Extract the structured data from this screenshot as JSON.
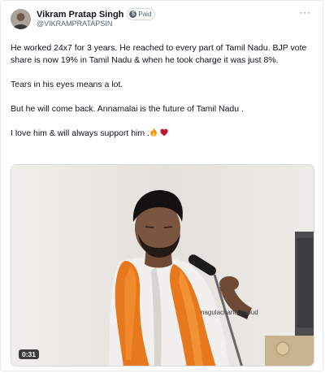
{
  "post": {
    "author_name": "Vikram Pratap Singh",
    "badge_label": "Paid",
    "handle": "@VIKRAMPRATAPSIN",
    "more_label": "···",
    "paragraphs": [
      "He worked 24x7 for 3 years. He reached to every part of Tamil Nadu. BJP vote share is now 19% in Tamil Nadu & when he took charge it was just 8%.",
      "Tears in his eyes means a lot.",
      "But he will come back. Annamalai is the future of Tamil Nadu ."
    ],
    "last_line": "I love him & will always support him .",
    "emojis": [
      "fire-emoji",
      "red-heart-emoji"
    ]
  },
  "video": {
    "watermark": "nagulachandurupud",
    "duration": "0:31"
  },
  "colors": {
    "secondary_text": "#536471",
    "border": "#e6e9ec",
    "saffron": "#e8781e"
  }
}
